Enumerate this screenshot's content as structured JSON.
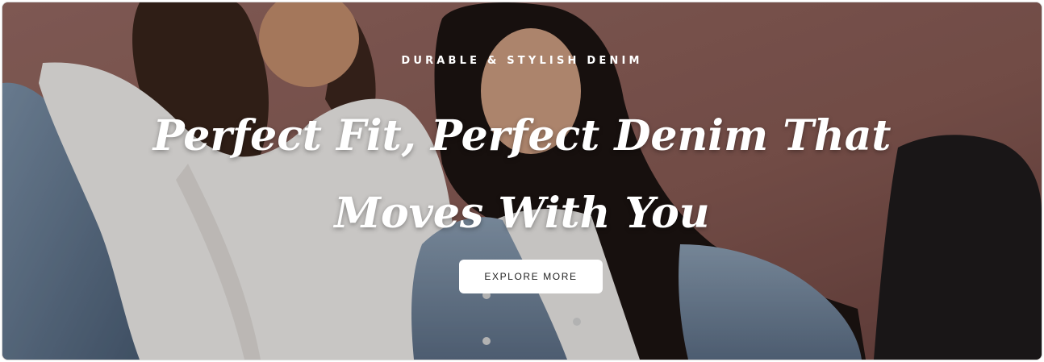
{
  "hero": {
    "eyebrow": "DURABLE & STYLISH DENIM",
    "headline_line1": "Perfect Fit, Perfect Denim That",
    "headline_line2": "Moves With You",
    "cta_label": "EXPLORE MORE"
  },
  "colors": {
    "backdrop": "#8a5f58",
    "text": "#ffffff",
    "button_bg": "#ffffff",
    "button_text": "#1e1e1e"
  }
}
